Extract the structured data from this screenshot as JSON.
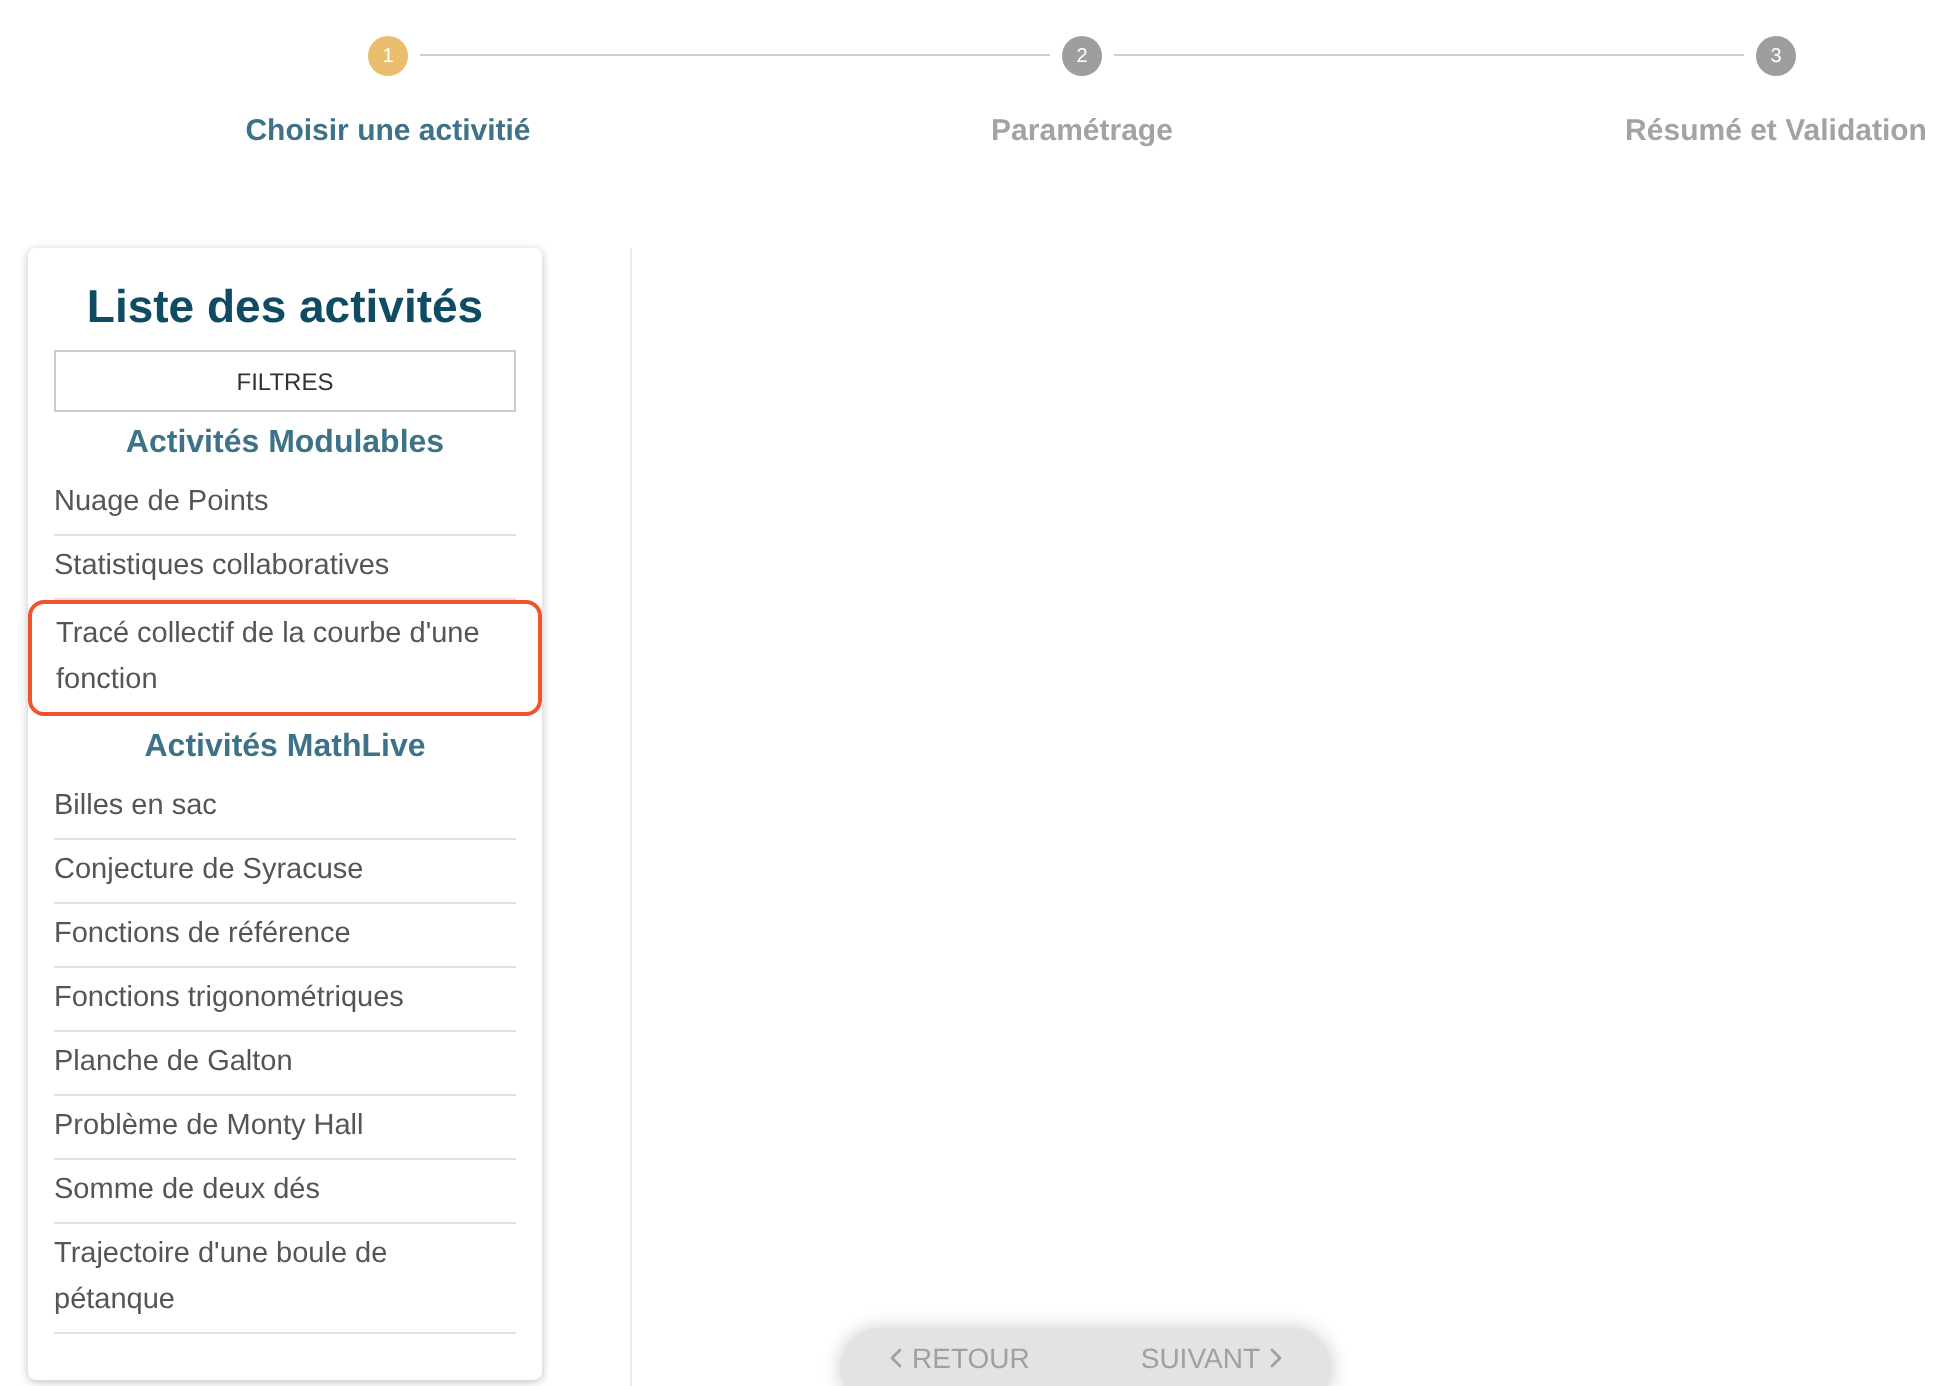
{
  "steps": [
    {
      "number": "1",
      "label": "Choisir une activitié",
      "selected": true
    },
    {
      "number": "2",
      "label": "Paramétrage",
      "selected": false
    },
    {
      "number": "3",
      "label": "Résumé et Validation",
      "selected": false
    }
  ],
  "panel": {
    "title": "Liste des activités",
    "filter_button": "FILTRES",
    "sections": [
      {
        "heading": "Activités Modulables",
        "items": [
          {
            "label": "Nuage de Points",
            "highlighted": false
          },
          {
            "label": "Statistiques collaboratives",
            "highlighted": false
          },
          {
            "label": "Tracé collectif de la courbe d'une fonction",
            "highlighted": true
          }
        ]
      },
      {
        "heading": "Activités MathLive",
        "items": [
          {
            "label": "Billes en sac",
            "highlighted": false
          },
          {
            "label": "Conjecture de Syracuse",
            "highlighted": false
          },
          {
            "label": "Fonctions de référence",
            "highlighted": false
          },
          {
            "label": "Fonctions trigonométriques",
            "highlighted": false
          },
          {
            "label": "Planche de Galton",
            "highlighted": false
          },
          {
            "label": "Problème de Monty Hall",
            "highlighted": false
          },
          {
            "label": "Somme de deux dés",
            "highlighted": false
          },
          {
            "label": "Trajectoire d'une boule de pétanque",
            "highlighted": false
          }
        ]
      }
    ]
  },
  "navigation": {
    "back": "RETOUR",
    "next": "SUIVANT"
  }
}
